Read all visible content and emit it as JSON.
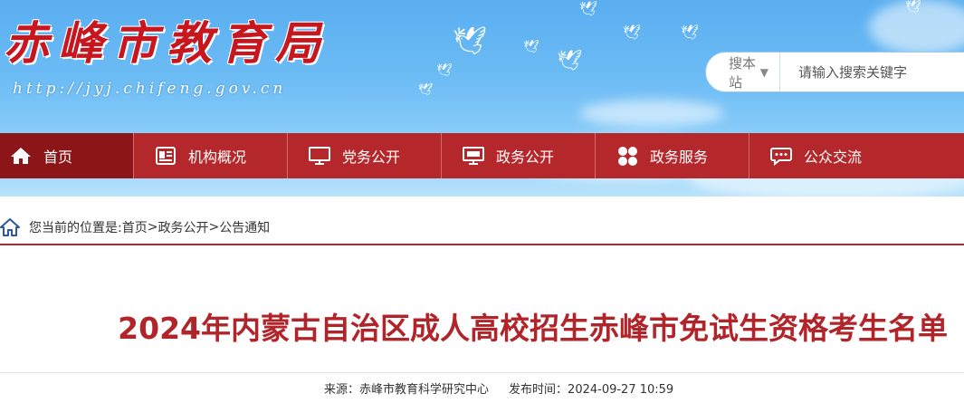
{
  "header": {
    "title": "赤峰市教育局",
    "url": "http://jyj.chifeng.gov.cn"
  },
  "search": {
    "scope_label": "搜本站",
    "placeholder": "请输入搜索关键字"
  },
  "nav": {
    "items": [
      {
        "label": "首页",
        "icon": "home-icon"
      },
      {
        "label": "机构概况",
        "icon": "document-icon"
      },
      {
        "label": "党务公开",
        "icon": "monitor-icon"
      },
      {
        "label": "政务公开",
        "icon": "screen-icon"
      },
      {
        "label": "政务服务",
        "icon": "grid-icon"
      },
      {
        "label": "公众交流",
        "icon": "chat-icon"
      }
    ]
  },
  "breadcrumb": {
    "prefix": "您当前的位置是:",
    "items": [
      "首页",
      "政务公开",
      "公告通知"
    ],
    "separator": ">"
  },
  "article": {
    "title": "2024年内蒙古自治区成人高校招生赤峰市免试生资格考生名单",
    "source_label": "来源：",
    "source": "赤峰市教育科学研究中心",
    "date_label": "发布时间：",
    "date": "2024-09-27 10:59"
  },
  "colors": {
    "brand_red": "#b4272b",
    "active_nav": "#8c1518",
    "title_red": "#b1252a",
    "sky": "#6cbcf5"
  }
}
